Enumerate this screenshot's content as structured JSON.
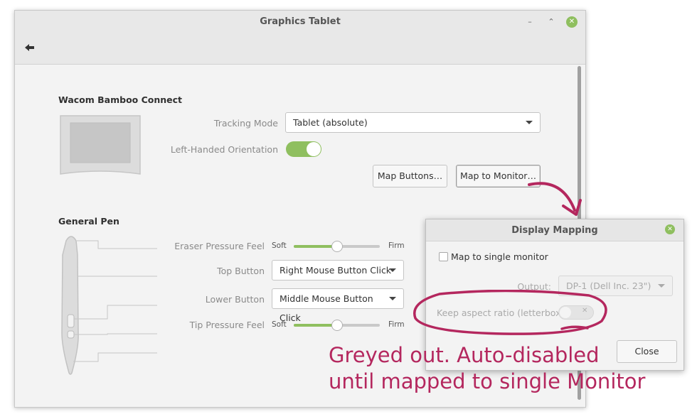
{
  "window": {
    "title": "Graphics Tablet",
    "controls": {
      "minimize": "–",
      "maximize": "⌃",
      "close": "✕"
    }
  },
  "tablet": {
    "section_title": "Wacom Bamboo Connect",
    "tracking_mode_label": "Tracking Mode",
    "tracking_mode_value": "Tablet (absolute)",
    "left_handed_label": "Left-Handed Orientation",
    "left_handed_on": true,
    "map_buttons_label": "Map Buttons…",
    "map_monitor_label": "Map to Monitor…"
  },
  "pen": {
    "section_title": "General Pen",
    "eraser_label": "Eraser Pressure Feel",
    "eraser_soft": "Soft",
    "eraser_firm": "Firm",
    "eraser_value": 0.5,
    "top_button_label": "Top Button",
    "top_button_value": "Right Mouse Button Click",
    "lower_button_label": "Lower Button",
    "lower_button_value": "Middle Mouse Button Click",
    "tip_label": "Tip Pressure Feel",
    "tip_soft": "Soft",
    "tip_firm": "Firm",
    "tip_value": 0.5
  },
  "dialog": {
    "title": "Display Mapping",
    "single_monitor_label": "Map to single monitor",
    "single_monitor_checked": false,
    "output_label": "Output:",
    "output_value": "DP-1 (Dell Inc. 23\")",
    "keep_aspect_label": "Keep aspect ratio (letterbox):",
    "keep_aspect_on": false,
    "close_label": "Close"
  },
  "annotation": {
    "text": "Greyed out. Auto-disabled\nuntil mapped to single Monitor",
    "color": "#b4275e"
  },
  "colors": {
    "accent": "#8fbf5f"
  }
}
